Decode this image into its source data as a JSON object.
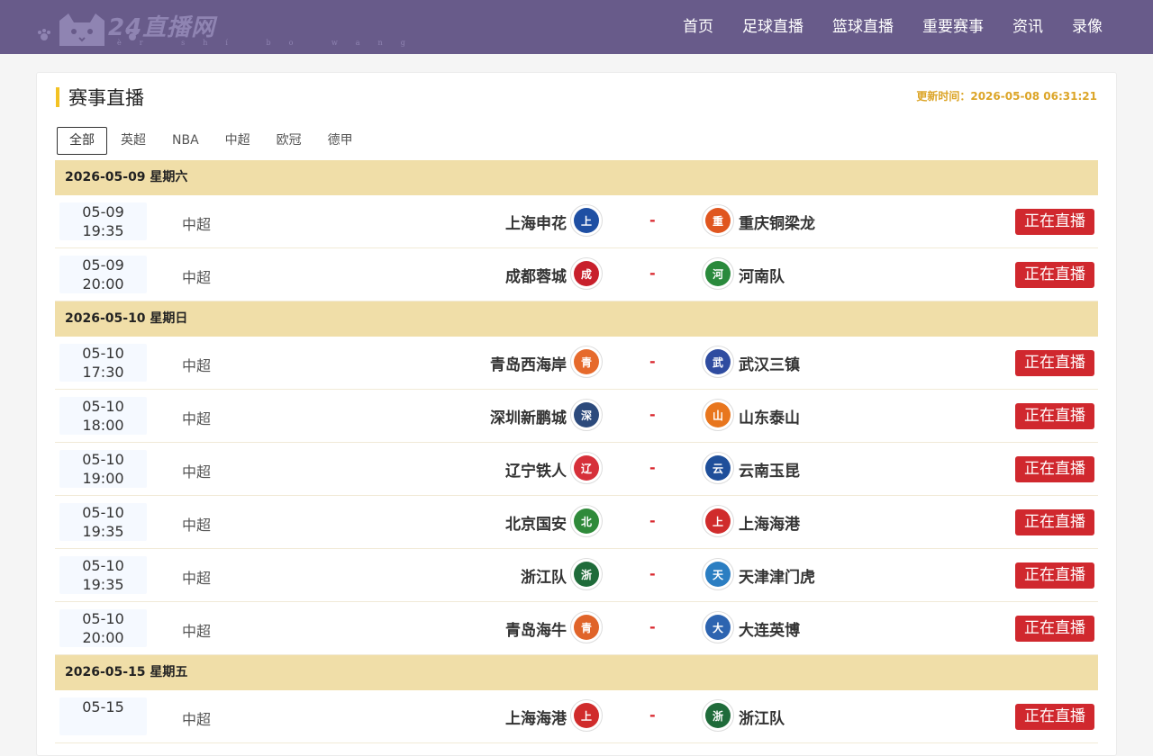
{
  "site": {
    "brand": "24直播网",
    "brand_pinyin": "èr shí bo wang"
  },
  "nav": [
    {
      "label": "首页"
    },
    {
      "label": "足球直播"
    },
    {
      "label": "篮球直播"
    },
    {
      "label": "重要赛事"
    },
    {
      "label": "资讯"
    },
    {
      "label": "录像"
    }
  ],
  "section": {
    "title": "赛事直播",
    "update_time": "更新时间：2026-05-08 06:31:21"
  },
  "tabs": [
    {
      "label": "全部",
      "active": true
    },
    {
      "label": "英超",
      "active": false
    },
    {
      "label": "NBA",
      "active": false
    },
    {
      "label": "中超",
      "active": false
    },
    {
      "label": "欧冠",
      "active": false
    },
    {
      "label": "德甲",
      "active": false
    }
  ],
  "days": [
    {
      "date": "2026-05-09 星期六",
      "matches": [
        {
          "date": "05-09",
          "time": "19:35",
          "league": "中超",
          "home": "上海申花",
          "away": "重庆铜梁龙",
          "score": "-",
          "status": "正在直播",
          "home_color": "#1e4fa3",
          "away_color": "#e0561f"
        },
        {
          "date": "05-09",
          "time": "20:00",
          "league": "中超",
          "home": "成都蓉城",
          "away": "河南队",
          "score": "-",
          "status": "正在直播",
          "home_color": "#c8202c",
          "away_color": "#2a8a3c"
        }
      ]
    },
    {
      "date": "2026-05-10 星期日",
      "matches": [
        {
          "date": "05-10",
          "time": "17:30",
          "league": "中超",
          "home": "青岛西海岸",
          "away": "武汉三镇",
          "score": "-",
          "status": "正在直播",
          "home_color": "#e66a2c",
          "away_color": "#2f4ca0"
        },
        {
          "date": "05-10",
          "time": "18:00",
          "league": "中超",
          "home": "深圳新鹏城",
          "away": "山东泰山",
          "score": "-",
          "status": "正在直播",
          "home_color": "#2c4a7c",
          "away_color": "#e8761e"
        },
        {
          "date": "05-10",
          "time": "19:00",
          "league": "中超",
          "home": "辽宁铁人",
          "away": "云南玉昆",
          "score": "-",
          "status": "正在直播",
          "home_color": "#d6303a",
          "away_color": "#1f4f9a"
        },
        {
          "date": "05-10",
          "time": "19:35",
          "league": "中超",
          "home": "北京国安",
          "away": "上海海港",
          "score": "-",
          "status": "正在直播",
          "home_color": "#2f8a3a",
          "away_color": "#d02c2c"
        },
        {
          "date": "05-10",
          "time": "19:35",
          "league": "中超",
          "home": "浙江队",
          "away": "天津津门虎",
          "score": "-",
          "status": "正在直播",
          "home_color": "#1f6b3a",
          "away_color": "#2b7ec2"
        },
        {
          "date": "05-10",
          "time": "20:00",
          "league": "中超",
          "home": "青岛海牛",
          "away": "大连英博",
          "score": "-",
          "status": "正在直播",
          "home_color": "#e0642a",
          "away_color": "#2d64b0"
        }
      ]
    },
    {
      "date": "2026-05-15 星期五",
      "matches": [
        {
          "date": "05-15",
          "time": "",
          "league": "中超",
          "home": "上海海港",
          "away": "浙江队",
          "score": "-",
          "status": "正在直播",
          "home_color": "#d02c2c",
          "away_color": "#1f6b3a"
        }
      ]
    }
  ]
}
